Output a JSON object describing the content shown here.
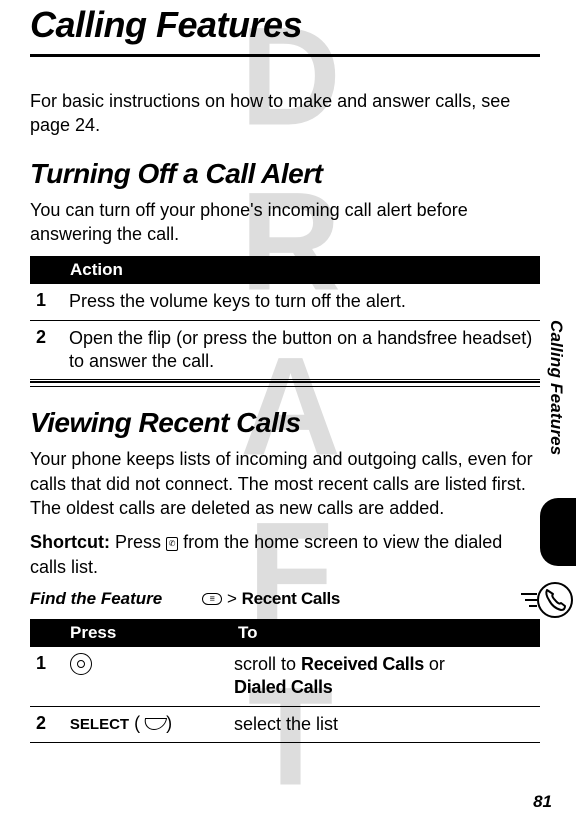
{
  "watermark": "DRAFT",
  "page_title": "Calling Features",
  "intro": "For basic instructions on how to make and answer calls, see page 24.",
  "section1": {
    "title": "Turning Off a Call Alert",
    "text": "You can turn off your phone's incoming call alert before answering the call.",
    "table_header": "Action",
    "rows": [
      {
        "n": "1",
        "text": "Press the volume keys to turn off the alert."
      },
      {
        "n": "2",
        "text": "Open the flip (or press the button on a handsfree headset) to answer the call."
      }
    ]
  },
  "section2": {
    "title": "Viewing Recent Calls",
    "text": "Your phone keeps lists of incoming and outgoing calls, even for calls that did not connect. The most recent calls are listed first. The oldest calls are deleted as new calls are added.",
    "shortcut_prefix": "Shortcut:",
    "shortcut_text_a": "Press",
    "shortcut_text_b": "from the home screen to view the dialed calls list.",
    "find_label": "Find the Feature",
    "find_path_sep": ">",
    "find_path_item": "Recent Calls",
    "table_header_press": "Press",
    "table_header_to": "To",
    "rows": [
      {
        "n": "1",
        "press_icon": "nav",
        "to_a": "scroll to",
        "to_b": "Received Calls",
        "to_c": "or",
        "to_d": "Dialed Calls"
      },
      {
        "n": "2",
        "press_label": "SELECT",
        "to": "select the list"
      }
    ]
  },
  "sidebar_label": "Calling Features",
  "page_number": "81"
}
